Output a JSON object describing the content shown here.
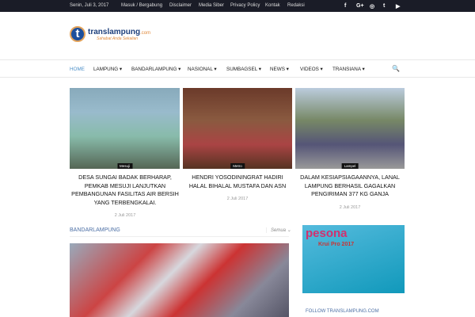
{
  "topbar": {
    "date": "Senin, Juli 3, 2017",
    "links": [
      "Masuk / Bergabung",
      "Disclaimer",
      "Media Siber",
      "Privacy Policy",
      "Kontak",
      "Redaksi"
    ],
    "social": [
      "f",
      "G+",
      "◎",
      "t",
      "▶"
    ]
  },
  "logo": {
    "letter": "t",
    "name": "translampung",
    "suffix": ".com",
    "tagline": "Sahabat Anda Sekalian"
  },
  "nav": {
    "items": [
      "HOME",
      "LAMPUNG ▾",
      "BANDARLAMPUNG ▾",
      "NASIONAL ▾",
      "SUMBAGSEL ▾",
      "NEWS ▾",
      "VIDEOS ▾",
      "TRANSIANA ▾"
    ],
    "search": "🔍"
  },
  "featured": [
    {
      "category": "Mesuji",
      "title": "Desa Sungai Badak Berharap, Pemkab Mesuji Lanjutkan Pembangunan Fasilitas Air Bersih yang Terbengkalai.",
      "date": "2 Juli 2017"
    },
    {
      "category": "Metro",
      "title": "Hendri Yosodiningrat Hadiri Halal Bihalal Mustafa dan ASN",
      "date": "2 Juli 2017"
    },
    {
      "category": "Lampel",
      "title": "Dalam Kesiapsiagaannya, Lanal Lampung Berhasil Gagalkan Pengiriman 377 Kg Ganja",
      "date": "2 Juli 2017"
    }
  ],
  "section": {
    "title": "BANDARLAMPUNG",
    "filter": "Semua ⌄"
  },
  "ad": {
    "brand": "pesona",
    "text": "Krui Pro 2017"
  },
  "sidebar": {
    "follow": "FOLLOW TRANSLAMPUNG.COM"
  }
}
